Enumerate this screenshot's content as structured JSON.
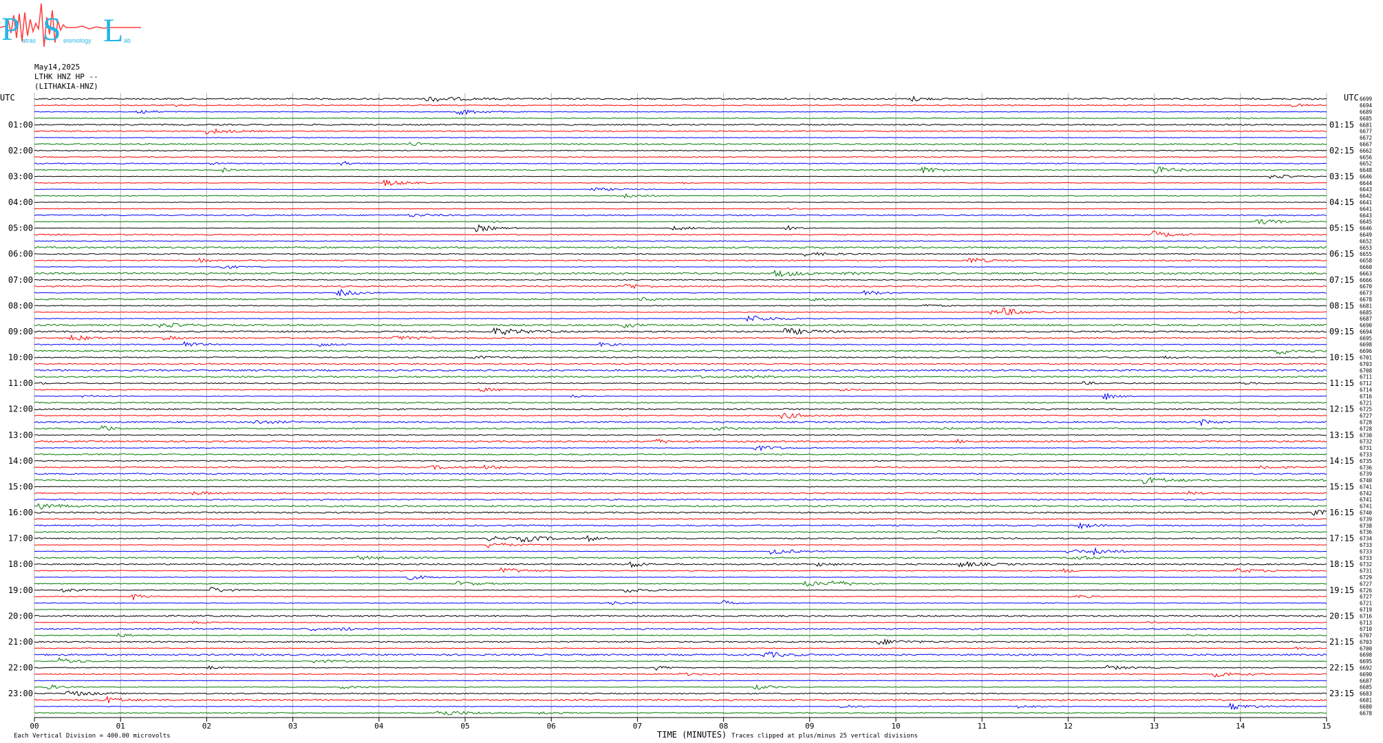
{
  "logo": {
    "letters": [
      "P",
      "S",
      "L"
    ],
    "small_text": [
      "atras",
      "eismology",
      "ab"
    ],
    "colors": {
      "letters": "#28b4e6",
      "wave": "#ff3c3c"
    }
  },
  "header": {
    "date": "May14,2025",
    "channel": "LTHK HNZ HP --",
    "station": "(LITHAKIA-HNZ)"
  },
  "footer": {
    "scale_text": "Each Vertical Division =  400.00 microvolts",
    "xlabel": "TIME (MINUTES)",
    "clip_text": "Traces clipped at plus/minus 25 vertical divisions"
  },
  "chart_data": {
    "type": "line",
    "title": "",
    "xlabel": "TIME (MINUTES)",
    "ylabel": "",
    "xlim": [
      0,
      15
    ],
    "x_ticks": [
      "00",
      "01",
      "02",
      "03",
      "04",
      "05",
      "06",
      "07",
      "08",
      "09",
      "10",
      "11",
      "12",
      "13",
      "14",
      "15"
    ],
    "left_axis_title": "UTC",
    "right_axis_title": "UTC",
    "left_hour_labels": [
      "01:00",
      "02:00",
      "03:00",
      "04:00",
      "05:00",
      "06:00",
      "07:00",
      "08:00",
      "09:00",
      "10:00",
      "11:00",
      "12:00",
      "13:00",
      "14:00",
      "15:00",
      "16:00",
      "17:00",
      "18:00",
      "19:00",
      "20:00",
      "21:00",
      "22:00",
      "23:00"
    ],
    "right_hour_labels": [
      "01:15",
      "02:15",
      "03:15",
      "04:15",
      "05:15",
      "06:15",
      "07:15",
      "08:15",
      "09:15",
      "10:15",
      "11:15",
      "12:15",
      "13:15",
      "14:15",
      "15:15",
      "16:15",
      "17:15",
      "18:15",
      "19:15",
      "20:15",
      "21:15",
      "22:15",
      "23:15"
    ],
    "trace_minutes": 15,
    "trace_count": 96,
    "trace_colors": [
      "#000000",
      "#ff0000",
      "#0000ff",
      "#007a00"
    ],
    "grid": "vertical lines every minute",
    "right_trace_values": [
      "6699",
      "6694",
      "6689",
      "6685",
      "6681",
      "6677",
      "6672",
      "6667",
      "6662",
      "6656",
      "6652",
      "6648",
      "6646",
      "6644",
      "6643",
      "6642",
      "6641",
      "6641",
      "6643",
      "6645",
      "6646",
      "6649",
      "6652",
      "6653",
      "6655",
      "6658",
      "6660",
      "6663",
      "6666",
      "6670",
      "6673",
      "6678",
      "6681",
      "6685",
      "6687",
      "6690",
      "6694",
      "6695",
      "6698",
      "6696",
      "6701",
      "6703",
      "6708",
      "6711",
      "6712",
      "6714",
      "6716",
      "6721",
      "6725",
      "6727",
      "6728",
      "6728",
      "6730",
      "6732",
      "6731",
      "6733",
      "6735",
      "6736",
      "6739",
      "6740",
      "6741",
      "6742",
      "6741",
      "6741",
      "6740",
      "6739",
      "6738",
      "6736",
      "6734",
      "6733",
      "6733",
      "6733",
      "6732",
      "6731",
      "6729",
      "6727",
      "6726",
      "6727",
      "6721",
      "6719",
      "6716",
      "6713",
      "6710",
      "6707",
      "6703",
      "6700",
      "6698",
      "6695",
      "6692",
      "6690",
      "6687",
      "6685",
      "6683",
      "6681",
      "6680",
      "6678"
    ]
  }
}
